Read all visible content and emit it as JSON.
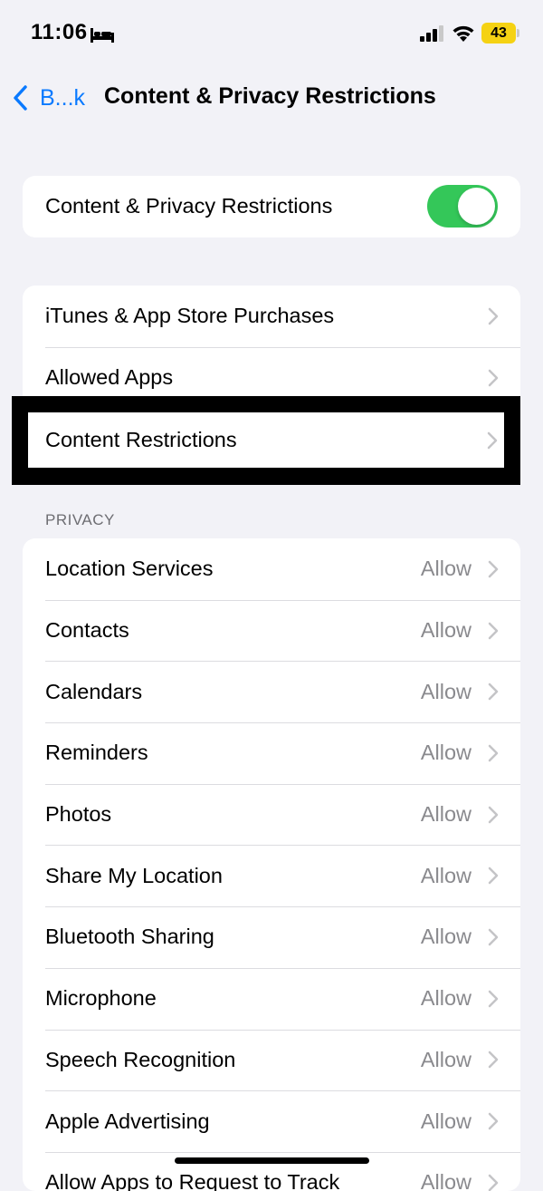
{
  "status_bar": {
    "time": "11:06",
    "battery": "43",
    "battery_color": "#f5d213"
  },
  "nav": {
    "back_label": "B...k",
    "title": "Content & Privacy Restrictions",
    "accent_color": "#0a7aff"
  },
  "master_toggle": {
    "label": "Content & Privacy Restrictions",
    "on": true,
    "on_color": "#34c759"
  },
  "store_group": {
    "items": [
      {
        "label": "iTunes & App Store Purchases"
      },
      {
        "label": "Allowed Apps"
      }
    ]
  },
  "highlighted_item": {
    "label": "Content Restrictions"
  },
  "privacy": {
    "header": "PRIVACY",
    "items": [
      {
        "label": "Location Services",
        "value": "Allow"
      },
      {
        "label": "Contacts",
        "value": "Allow"
      },
      {
        "label": "Calendars",
        "value": "Allow"
      },
      {
        "label": "Reminders",
        "value": "Allow"
      },
      {
        "label": "Photos",
        "value": "Allow"
      },
      {
        "label": "Share My Location",
        "value": "Allow"
      },
      {
        "label": "Bluetooth Sharing",
        "value": "Allow"
      },
      {
        "label": "Microphone",
        "value": "Allow"
      },
      {
        "label": "Speech Recognition",
        "value": "Allow"
      },
      {
        "label": "Apple Advertising",
        "value": "Allow"
      },
      {
        "label": "Allow Apps to Request to Track",
        "value": "Allow"
      }
    ]
  }
}
